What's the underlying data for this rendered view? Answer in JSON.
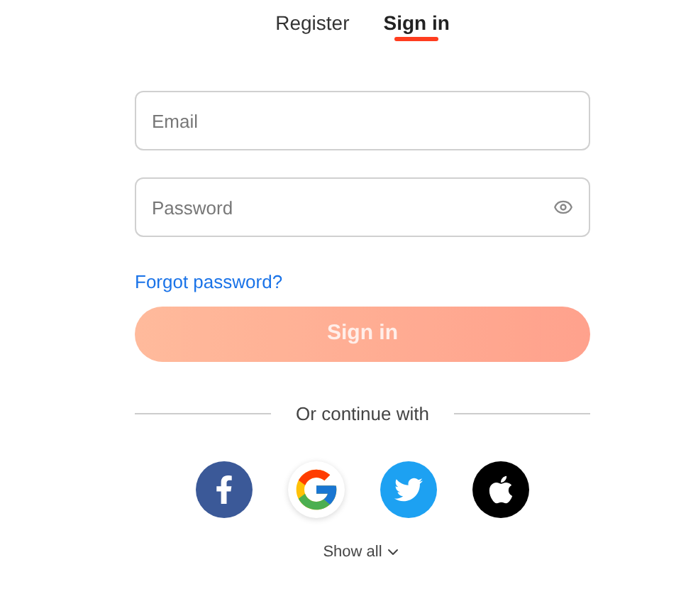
{
  "tabs": [
    {
      "label": "Register",
      "selected": false
    },
    {
      "label": "Sign in",
      "selected": true
    }
  ],
  "fields": [
    {
      "kind": "email",
      "placeholder": "Email"
    },
    {
      "kind": "password",
      "placeholder": "Password"
    }
  ],
  "forgot_link": "Forgot password?",
  "submit_button": {
    "label": "Sign in",
    "disabled": true
  },
  "divider_text": "Or continue with",
  "social": [
    {
      "kind": "facebook"
    },
    {
      "kind": "google"
    },
    {
      "kind": "twitter"
    },
    {
      "kind": "apple"
    }
  ],
  "show_all": "Show all"
}
